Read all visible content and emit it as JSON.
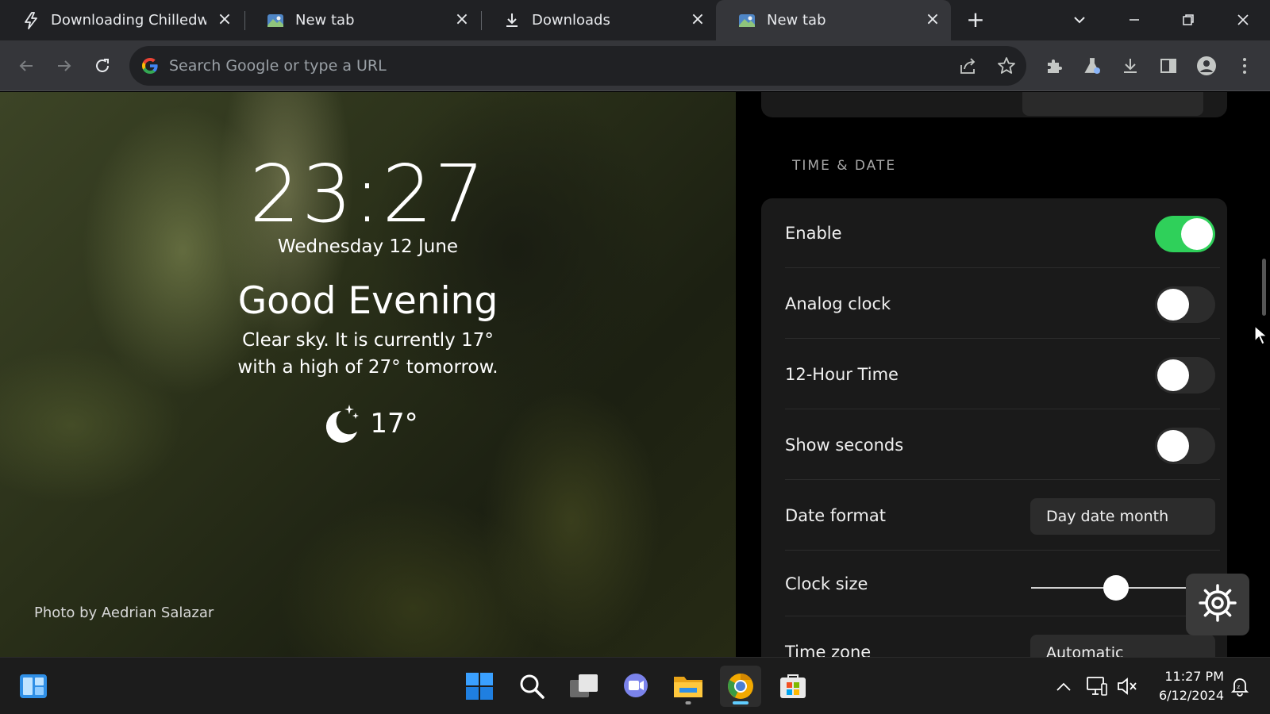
{
  "tabs": [
    {
      "title": "Downloading Chilledwindows",
      "icon": "bolt-icon"
    },
    {
      "title": "New tab",
      "icon": "landscape-icon"
    },
    {
      "title": "Downloads",
      "icon": "download-icon"
    },
    {
      "title": "New tab",
      "icon": "landscape-icon"
    }
  ],
  "omnibox": {
    "placeholder": "Search Google or type a URL"
  },
  "newtab": {
    "clock": "23:27",
    "date": "Wednesday 12 June",
    "greeting": "Good Evening",
    "weather_line1": "Clear sky. It is currently 17°",
    "weather_line2": "with a high of 27° tomorrow.",
    "current_temp": "17°",
    "photo_credit": "Photo by Aedrian Salazar"
  },
  "settings": {
    "section_title": "TIME & DATE",
    "rows": {
      "enable": {
        "label": "Enable",
        "on": true
      },
      "analog": {
        "label": "Analog clock",
        "on": false
      },
      "hour12": {
        "label": "12-Hour Time",
        "on": false
      },
      "seconds": {
        "label": "Show seconds",
        "on": false
      },
      "date_format": {
        "label": "Date format",
        "value": "Day date month"
      },
      "clock_size": {
        "label": "Clock size",
        "level": 0.45
      },
      "time_zone": {
        "label": "Time zone",
        "value": "Automatic"
      }
    }
  },
  "taskbar": {
    "time": "11:27 PM",
    "date": "6/12/2024"
  },
  "colors": {
    "toggle_on": "#2fd05a",
    "accent": "#60cdff"
  }
}
